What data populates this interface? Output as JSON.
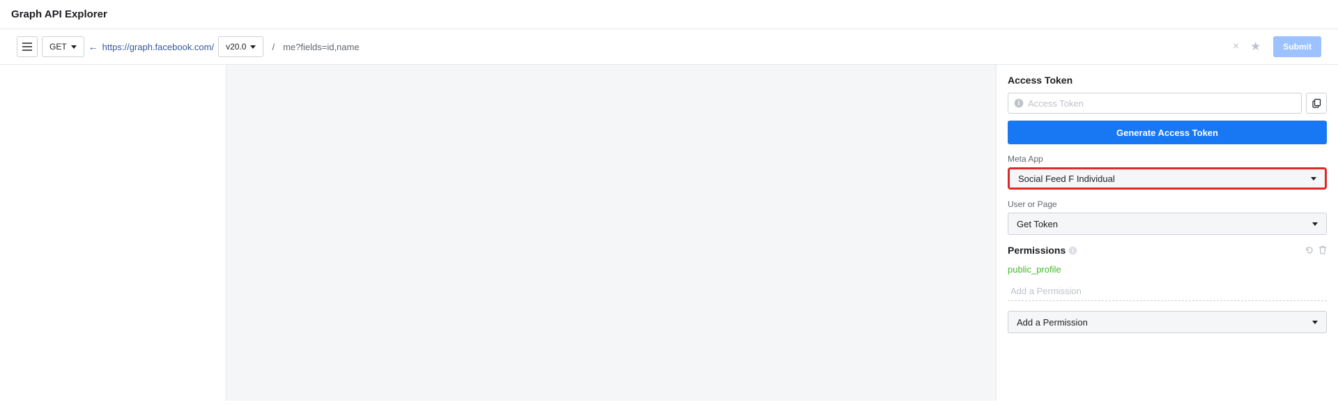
{
  "header": {
    "title": "Graph API Explorer"
  },
  "toolbar": {
    "method": "GET",
    "base_url": "https://graph.facebook.com/",
    "version": "v20.0",
    "query": "me?fields=id,name",
    "submit_label": "Submit"
  },
  "right": {
    "access_token_title": "Access Token",
    "access_token_placeholder": "Access Token",
    "generate_label": "Generate Access Token",
    "meta_app_label": "Meta App",
    "meta_app_value": "Social Feed F Individual",
    "user_or_page_label": "User or Page",
    "user_or_page_value": "Get Token",
    "permissions_title": "Permissions",
    "permissions": [
      "public_profile"
    ],
    "add_permission_placeholder": "Add a Permission",
    "add_permission_dropdown": "Add a Permission"
  }
}
